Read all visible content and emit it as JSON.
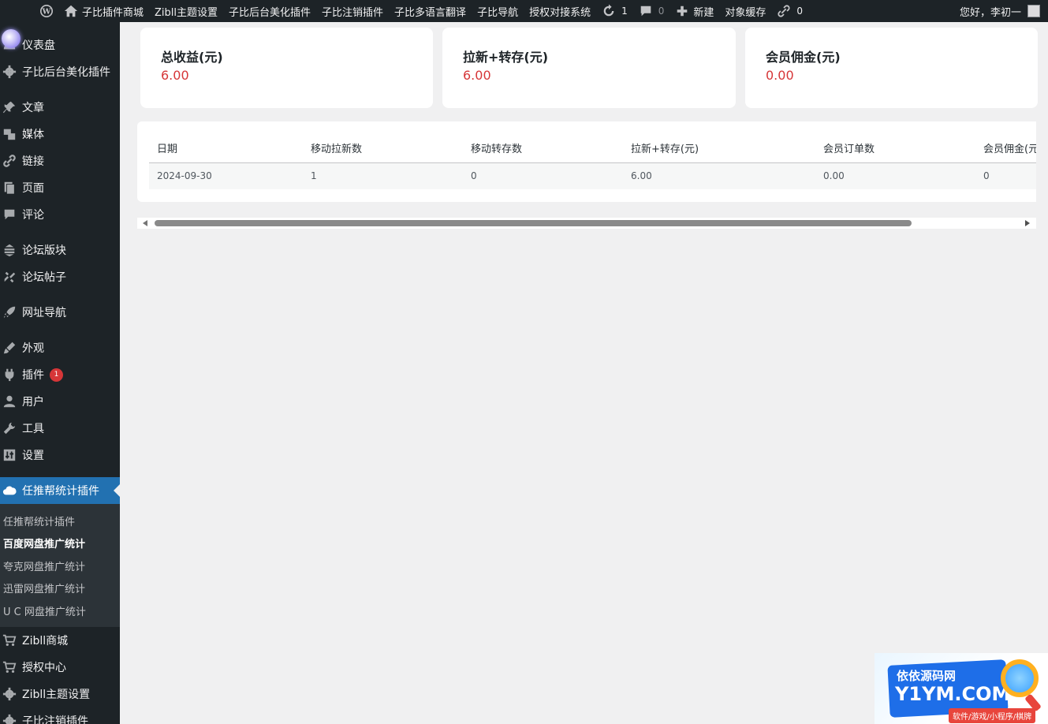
{
  "adminbar": {
    "items": [
      "子比插件商城",
      "Zibll主题设置",
      "子比后台美化插件",
      "子比注销插件",
      "子比多语言翻译",
      "子比导航",
      "授权对接系统"
    ],
    "updates_count": "1",
    "comments_count": "0",
    "new_label": "新建",
    "cache_label": "对象缓存",
    "links_count": "0",
    "greeting": "您好，李初一"
  },
  "sidebar": {
    "items": [
      {
        "label": "仪表盘",
        "icon": "dashboard-icon"
      },
      {
        "label": "子比后台美化插件",
        "icon": "gear-icon"
      },
      {
        "label": "文章",
        "icon": "pin-icon"
      },
      {
        "label": "媒体",
        "icon": "media-icon"
      },
      {
        "label": "链接",
        "icon": "link-icon"
      },
      {
        "label": "页面",
        "icon": "page-icon"
      },
      {
        "label": "评论",
        "icon": "comment-icon"
      },
      {
        "label": "论坛版块",
        "icon": "forum-icon"
      },
      {
        "label": "论坛帖子",
        "icon": "post-icon"
      },
      {
        "label": "网址导航",
        "icon": "rocket-icon"
      },
      {
        "label": "外观",
        "icon": "brush-icon"
      },
      {
        "label": "插件",
        "icon": "plugin-icon",
        "badge": "1"
      },
      {
        "label": "用户",
        "icon": "user-icon"
      },
      {
        "label": "工具",
        "icon": "wrench-icon"
      },
      {
        "label": "设置",
        "icon": "settings-icon"
      },
      {
        "label": "任推帮统计插件",
        "icon": "cloud-icon"
      },
      {
        "label": "Zibll商城",
        "icon": "cart-icon"
      },
      {
        "label": "授权中心",
        "icon": "cart-icon"
      },
      {
        "label": "Zibll主题设置",
        "icon": "gear-icon"
      },
      {
        "label": "子比注销插件",
        "icon": "gear-icon"
      }
    ],
    "submenu": [
      "任推帮统计插件",
      "百度网盘推广统计",
      "夸克网盘推广统计",
      "迅雷网盘推广统计",
      "U C 网盘推广统计"
    ],
    "accent": "#2271b1"
  },
  "cards": [
    {
      "title": "总收益(元)",
      "value": "6.00"
    },
    {
      "title": "拉新+转存(元)",
      "value": "6.00"
    },
    {
      "title": "会员佣金(元)",
      "value": "0.00"
    }
  ],
  "table": {
    "headers": [
      "日期",
      "移动拉新数",
      "移动转存数",
      "拉新+转存(元)",
      "会员订单数",
      "会员佣金(元)"
    ],
    "rows": [
      [
        "2024-09-30",
        "1",
        "0",
        "6.00",
        "0.00",
        "0"
      ]
    ]
  },
  "watermark": {
    "line1": "依依源码网",
    "line2": "Y1YM.COM",
    "tag": "软件/游戏/小程序/棋牌"
  }
}
